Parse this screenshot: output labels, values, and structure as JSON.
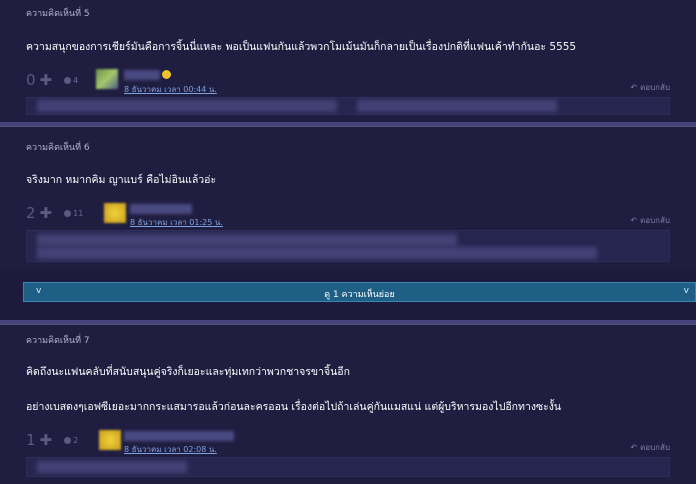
{
  "comments": [
    {
      "title": "ความคิดเห็นที่ 5",
      "lines": [
        "ความสนุกของการเชียร์มันคือการจิ้นนี่แหละ พอเป็นแฟนกันแล้วพวกโมเม้นมันก็กลายเป็นเรื่องปกติที่แฟนเค้าทำกันอะ 5555"
      ],
      "votes": "0",
      "emotions": "4",
      "date": "8 ธันวาคม เวลา 00:44 น.",
      "reply_label": "ตอบกลับ"
    },
    {
      "title": "ความคิดเห็นที่ 6",
      "lines": [
        "จริงมาก หมากคิม ญาแบร์ คือไม่อินแล้วอ่ะ"
      ],
      "votes": "2",
      "emotions": "11",
      "date": "8 ธันวาคม เวลา 01:25 น.",
      "reply_label": "ตอบกลับ"
    },
    {
      "title": "ความคิดเห็นที่ 7",
      "lines": [
        "คิดถึงนะแฟนคลับที่สนับสนุนคู่จริงก็เยอะและทุ่มเทกว่าพวกชาจรขาจิ้นอีก",
        "อย่างเบสดงๆเอฟซีเยอะมากกระแสมารอแล้วก่อนละครออน เรื่องต่อไปถ้าเล่นคู่กันแมสแน่ แต่ผู้บริหารมองไปอีกทางซะงั้น"
      ],
      "votes": "1",
      "emotions": "2",
      "date": "8 ธันวาคม เวลา 02:08 น.",
      "reply_label": "ตอบกลับ"
    }
  ],
  "expand": {
    "label": "ดู 1 ความเห็นย่อย",
    "icon": "chevron-down-icon"
  },
  "colors": {
    "background": "#1d1b3d",
    "accent_bar": "#1f5f86",
    "date_link": "#7fa1e0"
  }
}
